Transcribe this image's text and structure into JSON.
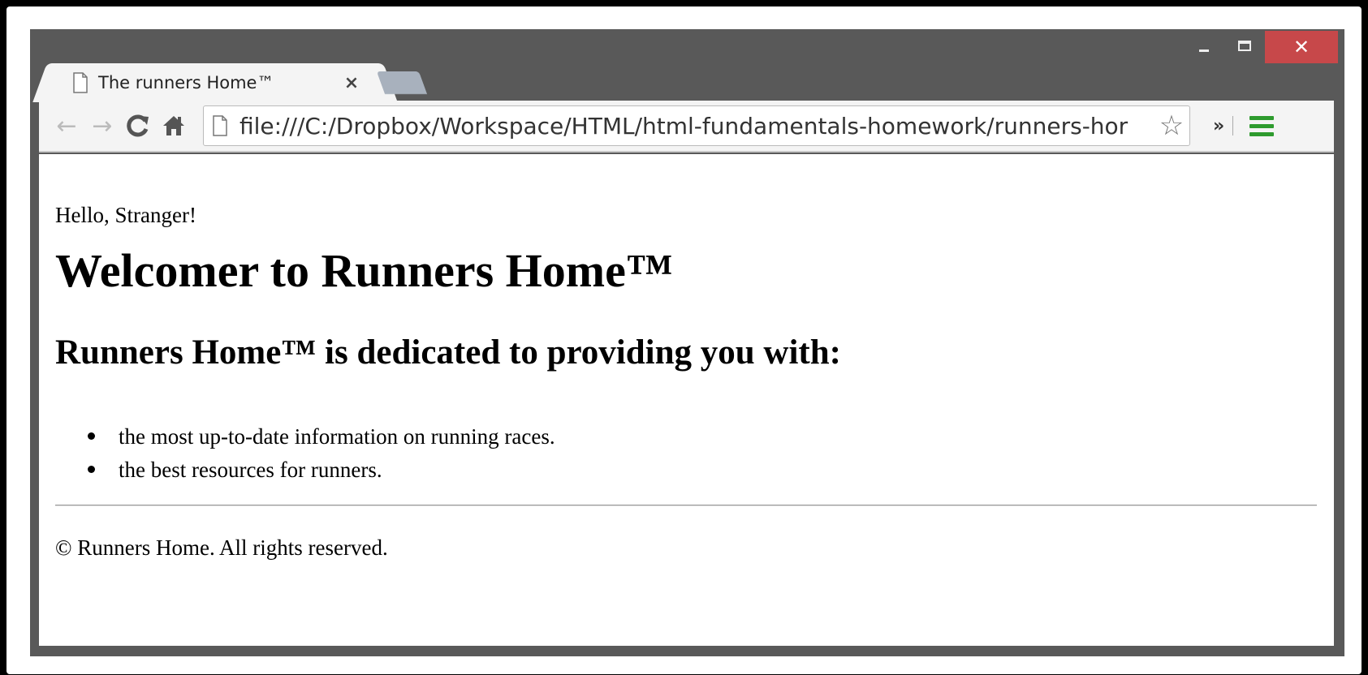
{
  "browser": {
    "tab": {
      "title": "The runners Home™",
      "close_glyph": "×"
    },
    "window_controls": {
      "minimize": "minimize",
      "maximize": "maximize",
      "close_glyph": "✕"
    },
    "toolbar": {
      "back_glyph": "←",
      "forward_glyph": "→",
      "reload_glyph": "C",
      "home_glyph": "⌂",
      "url": "file:///C:/Dropbox/Workspace/HTML/html-fundamentals-homework/runners-hor",
      "star_glyph": "☆",
      "more_glyph": "»"
    },
    "colors": {
      "close_button": "#c7484a",
      "menu_icon": "#2e9b2e",
      "chrome": "#595959"
    }
  },
  "page": {
    "greeting": "Hello, Stranger!",
    "heading": "Welcomer to Runners Home™",
    "subheading": "Runners Home™ is dedicated to providing you with:",
    "list_items": [
      "the most up-to-date information on running races.",
      "the best resources for runners."
    ],
    "footer": "© Runners Home. All rights reserved."
  }
}
